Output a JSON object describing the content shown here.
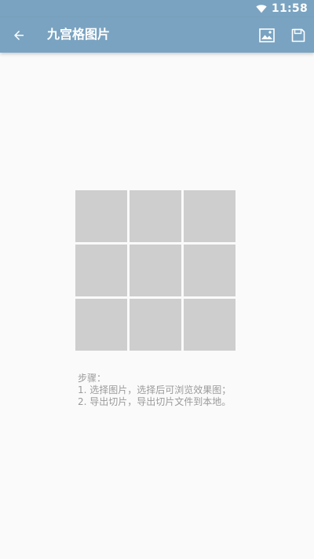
{
  "status_bar": {
    "time": "11:58",
    "wifi_icon": "wifi-icon"
  },
  "app_bar": {
    "title": "九宫格图片",
    "back_icon": "arrow-back-icon",
    "actions": [
      {
        "name": "image-icon"
      },
      {
        "name": "save-icon"
      }
    ],
    "background": "#7aa3c1"
  },
  "grid": {
    "rows": 3,
    "cols": 3,
    "cell_color": "#cecece"
  },
  "steps": {
    "heading": "步骤：",
    "lines": [
      "1. 选择图片，选择后可浏览效果图；",
      "2. 导出切片，导出切片文件到本地。"
    ]
  }
}
